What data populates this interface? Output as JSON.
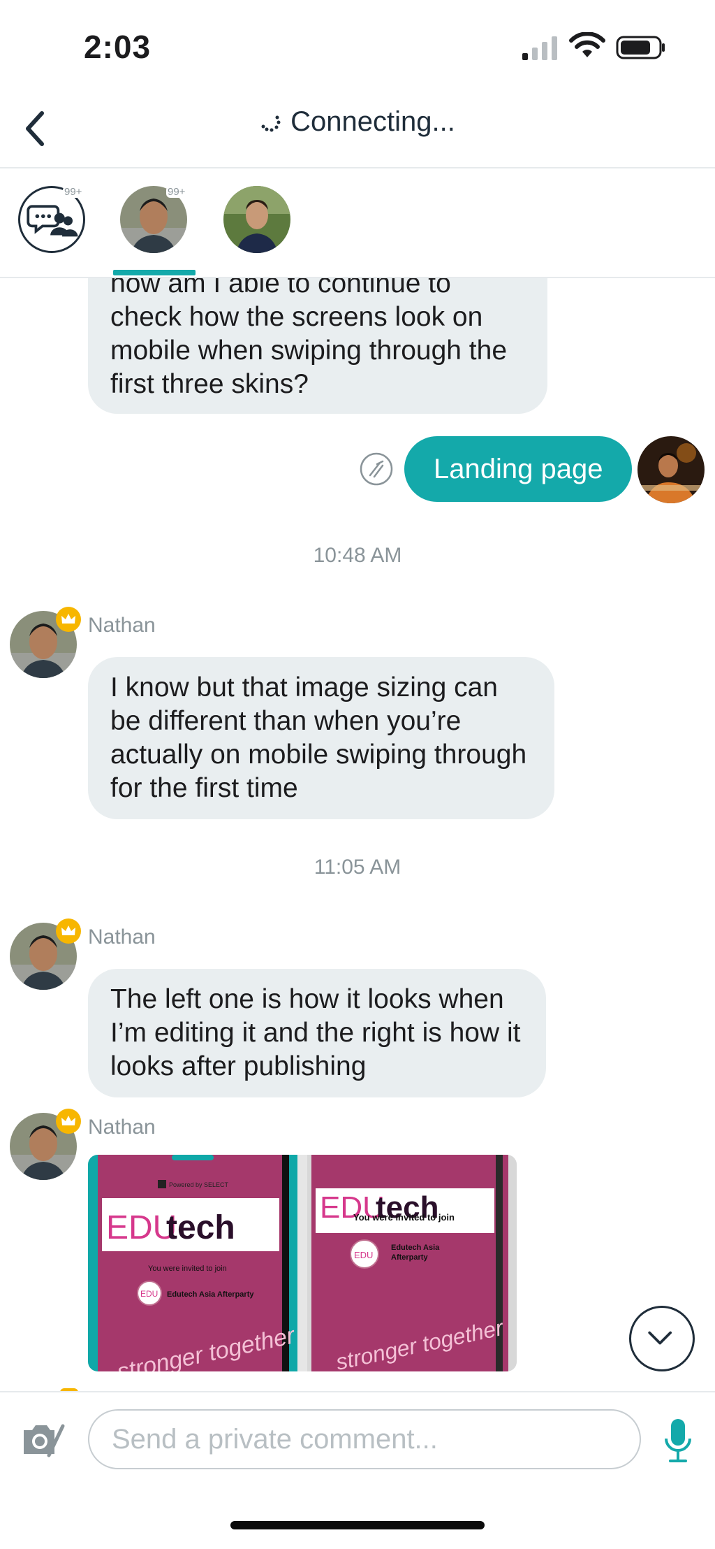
{
  "status_bar": {
    "time": "2:03"
  },
  "header": {
    "title": "Connecting..."
  },
  "participants": [
    {
      "name": "group-chat",
      "badge": "99+"
    },
    {
      "name": "nathan",
      "badge": "99+"
    },
    {
      "name": "participant-3",
      "badge": ""
    }
  ],
  "messages": {
    "m1_text": "how am I able to continue to check how the screens look on mobile when swiping through the first three skins?",
    "m2_outgoing": "Landing page",
    "ts1": "10:48 AM",
    "m3_sender": "Nathan",
    "m3_text": "I know but that image sizing can be different than when you’re actually on mobile swiping through for the first time",
    "ts2": "11:05 AM",
    "m4_sender": "Nathan",
    "m4_text": "The left one is how it looks when I’m editing it and the right is how it looks after publishing",
    "m5_sender": "Nathan"
  },
  "images": {
    "left": {
      "powered": "Powered by SELECT",
      "logo_a": "EDU",
      "logo_b": "tech",
      "invite": "You were invited to join",
      "event": "Edutech Asia Afterparty",
      "badge": "EDU",
      "script": "stronger together"
    },
    "right": {
      "logo_a": "EDU",
      "logo_b": "tech",
      "invite": "You were invited to join",
      "event_line1": "Edutech Asia",
      "event_line2": "Afterparty",
      "badge": "EDU",
      "script": "stronger together"
    }
  },
  "composer": {
    "placeholder": "Send a private comment..."
  },
  "colors": {
    "accent": "#14a9aa",
    "bubble": "#e9eef0",
    "muted": "#8a9499",
    "crown": "#f7b600",
    "image_bg": "#a5386b"
  }
}
